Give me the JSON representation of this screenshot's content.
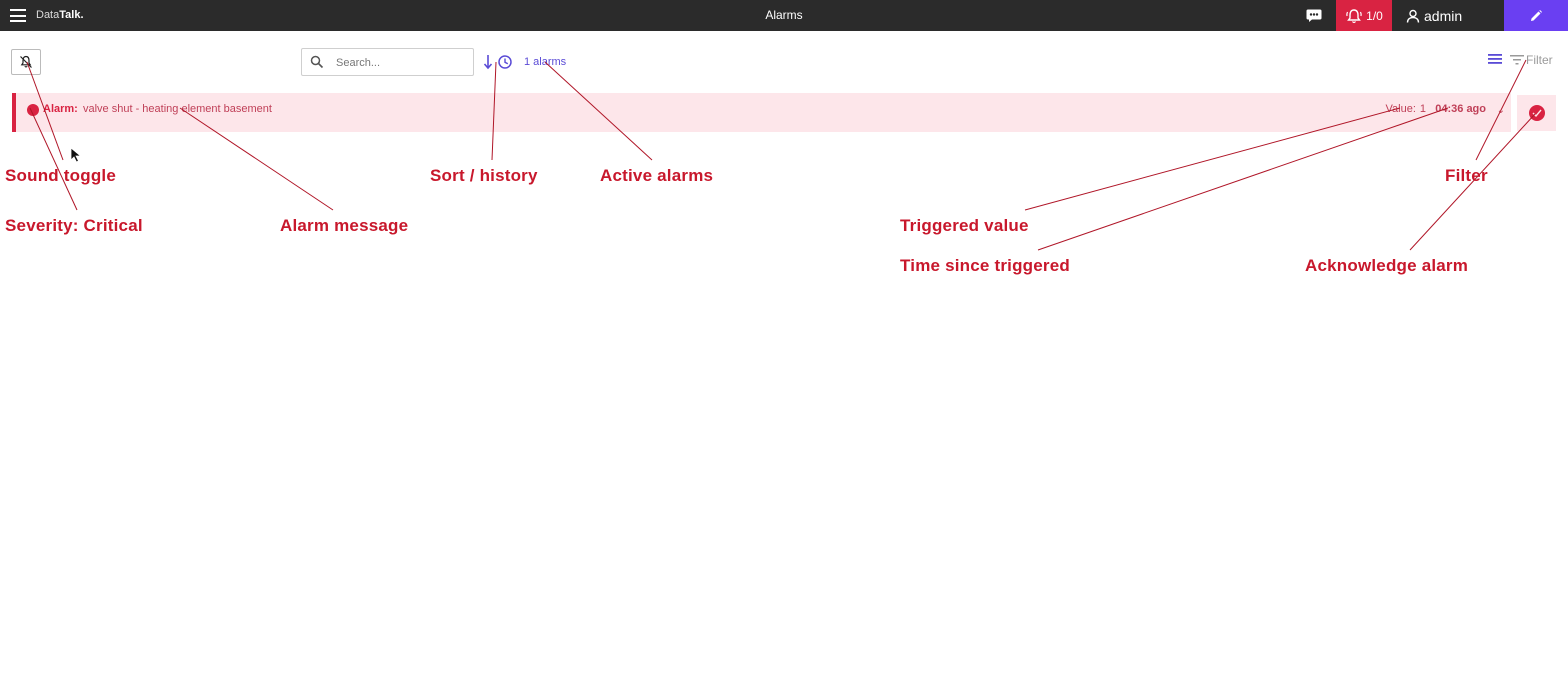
{
  "app": {
    "brand_prefix": "Data",
    "brand_suffix": "Talk.",
    "page_title": "Alarms"
  },
  "topbar": {
    "alarm_counter": "1/0",
    "user_name": "admin"
  },
  "toolbar": {
    "search_placeholder": "Search...",
    "alarm_count": "1 alarms",
    "filter_label": "Filter"
  },
  "alarm": {
    "label": "Alarm:",
    "message": "valve shut - heating element basement",
    "value_label": "Value:",
    "value": "1",
    "time_ago": "04:36 ago",
    "severity_color": "#d92342"
  },
  "annotations": {
    "sound_toggle": "Sound toggle",
    "severity": "Severity: Critical",
    "alarm_message": "Alarm message",
    "sort_history": "Sort / history",
    "active_alarms": "Active alarms",
    "triggered_value": "Triggered value",
    "time_since": "Time since triggered",
    "filter": "Filter",
    "acknowledge": "Acknowledge alarm"
  },
  "colors": {
    "topbar_bg": "#2b2b2b",
    "critical": "#d92342",
    "accent": "#6a3ff2",
    "row_bg": "#fde6ea",
    "annotation": "#c8182c"
  }
}
